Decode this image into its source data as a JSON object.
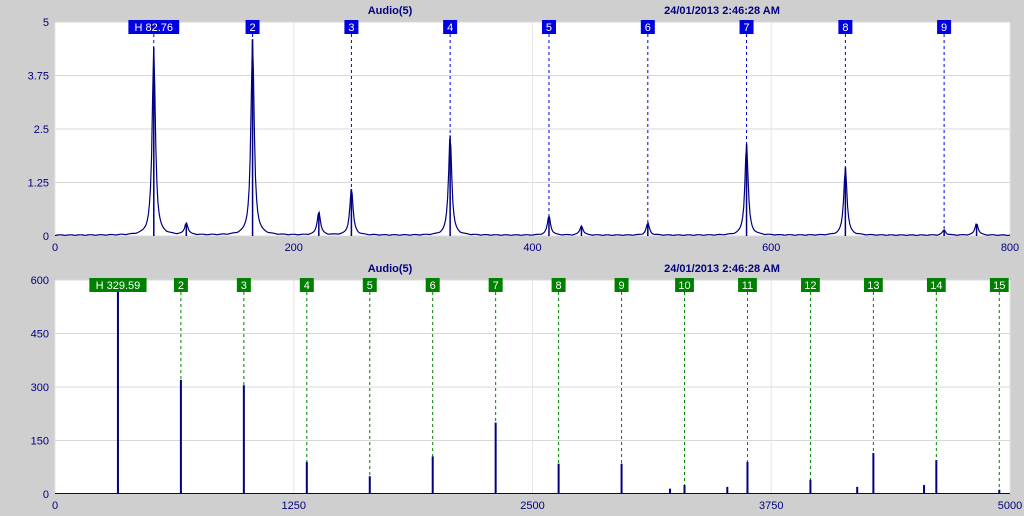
{
  "chart_data": [
    {
      "type": "line",
      "title": "Audio(5)",
      "timestamp": "24/01/2013 2:46:28 AM",
      "xlim": [
        0,
        800
      ],
      "ylim": [
        0,
        5
      ],
      "xticks": [
        "0",
        "200",
        "400",
        "600",
        "800"
      ],
      "xtick_values": [
        0,
        200,
        400,
        600,
        800
      ],
      "yticks": [
        "0",
        "1.25",
        "2.5",
        "3.75",
        "5"
      ],
      "ytick_values": [
        0,
        1.25,
        2.5,
        3.75,
        5
      ],
      "grid": true,
      "line_color": "#000080",
      "marker_color": "#0000e0",
      "markers": [
        {
          "label": "H 82.76",
          "x": 82.76
        },
        {
          "label": "2",
          "x": 165.5
        },
        {
          "label": "3",
          "x": 248.3
        },
        {
          "label": "4",
          "x": 331.0
        },
        {
          "label": "5",
          "x": 413.8
        },
        {
          "label": "6",
          "x": 496.6
        },
        {
          "label": "7",
          "x": 579.3
        },
        {
          "label": "8",
          "x": 662.1
        },
        {
          "label": "9",
          "x": 744.8
        }
      ],
      "peaks": [
        {
          "x": 82.76,
          "y": 4.4
        },
        {
          "x": 110,
          "y": 0.28
        },
        {
          "x": 165.5,
          "y": 4.6
        },
        {
          "x": 221,
          "y": 0.55
        },
        {
          "x": 248.3,
          "y": 1.1
        },
        {
          "x": 331.0,
          "y": 2.35
        },
        {
          "x": 413.8,
          "y": 0.45
        },
        {
          "x": 441,
          "y": 0.22
        },
        {
          "x": 496.6,
          "y": 0.28
        },
        {
          "x": 579.3,
          "y": 2.15
        },
        {
          "x": 662.1,
          "y": 1.6
        },
        {
          "x": 744.8,
          "y": 0.12
        },
        {
          "x": 772,
          "y": 0.28
        }
      ]
    },
    {
      "type": "bar",
      "title": "Audio(5)",
      "timestamp": "24/01/2013 2:46:28 AM",
      "xlim": [
        0,
        5000
      ],
      "ylim": [
        0,
        600
      ],
      "xticks": [
        "0",
        "1250",
        "2500",
        "3750",
        "5000"
      ],
      "xtick_values": [
        0,
        1250,
        2500,
        3750,
        5000
      ],
      "yticks": [
        "0",
        "150",
        "300",
        "450",
        "600"
      ],
      "ytick_values": [
        0,
        150,
        300,
        450,
        600
      ],
      "grid": true,
      "line_color": "#000080",
      "marker_color": "#008000",
      "markers": [
        {
          "label": "H 329.59",
          "x": 329.59
        },
        {
          "label": "2",
          "x": 659.2
        },
        {
          "label": "3",
          "x": 988.8
        },
        {
          "label": "4",
          "x": 1318.4
        },
        {
          "label": "5",
          "x": 1648.0
        },
        {
          "label": "6",
          "x": 1977.5
        },
        {
          "label": "7",
          "x": 2307.1
        },
        {
          "label": "8",
          "x": 2636.7
        },
        {
          "label": "9",
          "x": 2966.3
        },
        {
          "label": "10",
          "x": 3295.9
        },
        {
          "label": "11",
          "x": 3625.5
        },
        {
          "label": "12",
          "x": 3955.1
        },
        {
          "label": "13",
          "x": 4284.7
        },
        {
          "label": "14",
          "x": 4614.3
        },
        {
          "label": "15",
          "x": 4943.9
        }
      ],
      "peaks": [
        {
          "x": 329.59,
          "y": 590
        },
        {
          "x": 659.2,
          "y": 320
        },
        {
          "x": 988.8,
          "y": 305
        },
        {
          "x": 1318.4,
          "y": 90
        },
        {
          "x": 1648.0,
          "y": 50
        },
        {
          "x": 1977.5,
          "y": 105
        },
        {
          "x": 2307.1,
          "y": 200
        },
        {
          "x": 2636.7,
          "y": 85
        },
        {
          "x": 2966.3,
          "y": 85
        },
        {
          "x": 3220,
          "y": 15
        },
        {
          "x": 3295.9,
          "y": 25
        },
        {
          "x": 3520,
          "y": 20
        },
        {
          "x": 3625.5,
          "y": 90
        },
        {
          "x": 3955.1,
          "y": 40
        },
        {
          "x": 4200,
          "y": 20
        },
        {
          "x": 4284.7,
          "y": 115
        },
        {
          "x": 4550,
          "y": 25
        },
        {
          "x": 4614.3,
          "y": 95
        },
        {
          "x": 4943.9,
          "y": 12
        }
      ]
    }
  ]
}
